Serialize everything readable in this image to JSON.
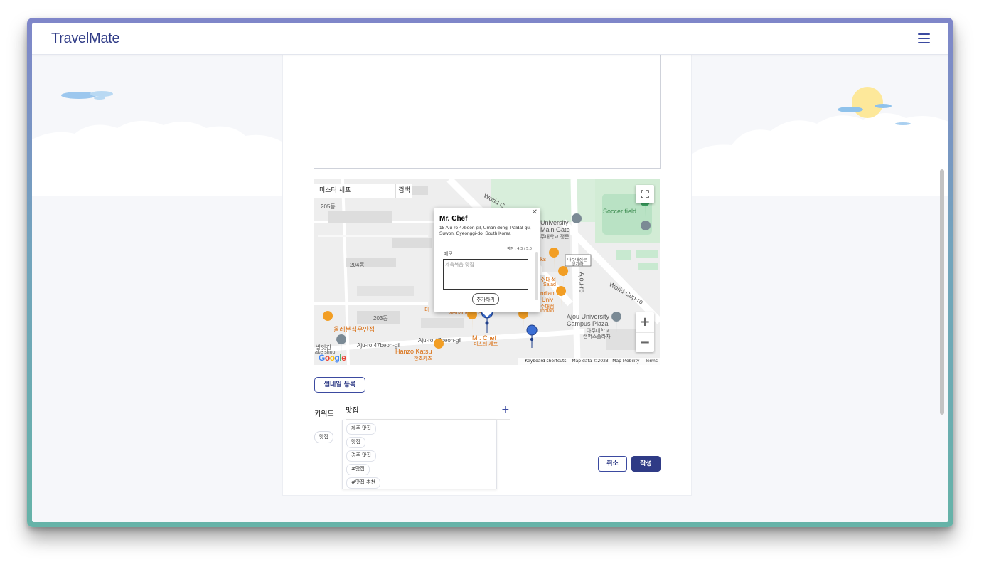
{
  "app": {
    "name": "TravelMate"
  },
  "map": {
    "search_value": "미스터 세프",
    "search_button": "검색",
    "keyboard_shortcuts": "Keyboard shortcuts",
    "map_data": "Map data ©2023 TMap Mobility",
    "terms": "Terms",
    "brand": "Google",
    "labels": {
      "b205": "205동",
      "b204": "204동",
      "b203": "203동",
      "world_cup": "World C",
      "world_cup_ro": "World Cup-ro",
      "univ": "University",
      "main_gate": "Main Gate",
      "main_gate_kr": "주대학교 정문",
      "soccer": "Soccer field",
      "ajou_shop": "아주대정문",
      "ajou_shop2": "상가라",
      "ajou_ro": "Ajou-ro",
      "ajou_plaza": "Ajou University",
      "ajou_plaza2": "Campus Plaza",
      "ajou_plaza_kr": "아주대학교",
      "ajou_plaza_kr2": "캠퍼스플라자",
      "olle": "올레분식우만점",
      "ajuro47": "Aju-ro 47beon-gil",
      "ajuro47b": "Aju-ro 47beon-gil",
      "mrchef": "Mr. Chef",
      "mrchef_kr": "미스터 세프",
      "hanzo": "Hanzo Katsu",
      "hanzo_kr": "한조카츠",
      "bangat": "방앗간",
      "cake": "ake shop",
      "ks": "ks",
      "salad": "주대점",
      "salad2": "Salad",
      "indian": "ndian",
      "univ2": "Univ",
      "jubu": "주대점",
      "indian2": "Indian",
      "mi": "미",
      "vietnamese": "Vietnamese - S"
    }
  },
  "popup": {
    "title": "Mr. Chef",
    "address": "18 Aju-ro 47beon-gil, Uman-dong, Paldal-gu, Suwon, Gyeonggi-do, South Korea",
    "rating": "평점 : 4.3 / 5.0",
    "memo_label": "메모",
    "memo_placeholder": "제육볶음 맛집",
    "add_button": "추가하기"
  },
  "form": {
    "thumbnail_button": "썸네일 등록",
    "keyword_label": "키워드",
    "keyword_value": "맛집",
    "added_tags": [
      "맛집"
    ],
    "suggestions": [
      "제주 맛집",
      "맛집",
      "경주 맛집",
      "#맛집",
      "#맛집 추천"
    ],
    "cancel_button": "취소",
    "submit_button": "작성"
  },
  "colors": {
    "brand": "#2f3b86",
    "pin_orange": "#f29e24",
    "pin_blue": "#3b6ed4"
  }
}
